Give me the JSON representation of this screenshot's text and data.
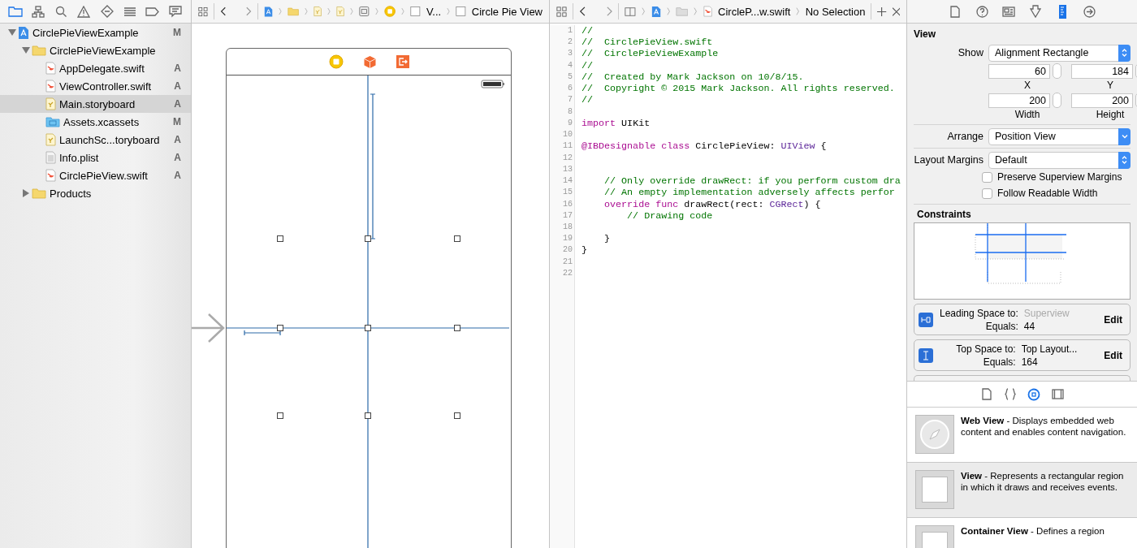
{
  "navigator": {
    "tabs": [
      {
        "kind": "folder",
        "selected": true
      },
      {
        "kind": "hierarchy",
        "selected": false
      },
      {
        "kind": "search",
        "selected": false
      },
      {
        "kind": "warning",
        "selected": false
      },
      {
        "kind": "diamond",
        "selected": false
      },
      {
        "kind": "list",
        "selected": false
      },
      {
        "kind": "tag",
        "selected": false
      },
      {
        "kind": "bubble",
        "selected": false
      }
    ],
    "tree": [
      {
        "name": "CirclePieViewExample",
        "kind": "project",
        "badge": "M",
        "expanded": true,
        "selected": false,
        "children": [
          {
            "name": "CirclePieViewExample",
            "kind": "folder",
            "expanded": true,
            "selected": false,
            "children": [
              {
                "name": "AppDelegate.swift",
                "kind": "swift",
                "badge": "A",
                "selected": false
              },
              {
                "name": "ViewController.swift",
                "kind": "swift",
                "badge": "A",
                "selected": false
              },
              {
                "name": "Main.storyboard",
                "kind": "storyboard",
                "badge": "A",
                "selected": true
              },
              {
                "name": "Assets.xcassets",
                "kind": "assets",
                "badge": "M",
                "selected": false
              },
              {
                "name": "LaunchSc...toryboard",
                "kind": "storyboard",
                "badge": "A",
                "selected": false
              },
              {
                "name": "Info.plist",
                "kind": "plist",
                "badge": "A",
                "selected": false
              },
              {
                "name": "CirclePieView.swift",
                "kind": "swift",
                "badge": "A",
                "selected": false
              }
            ]
          },
          {
            "name": "Products",
            "kind": "folder",
            "expanded": false,
            "selected": false
          }
        ]
      }
    ]
  },
  "canvas": {
    "breadcrumbs": [
      {
        "kind": "project"
      },
      {
        "kind": "folder"
      },
      {
        "kind": "storyboard"
      },
      {
        "kind": "storyboard"
      },
      {
        "kind": "scene"
      },
      {
        "kind": "controller"
      },
      {
        "kind": "view",
        "label": "V..."
      },
      {
        "kind": "view",
        "label": "Circle Pie View"
      }
    ]
  },
  "editor": {
    "jump_bar": [
      {
        "kind": "project"
      },
      {
        "kind": "folder"
      },
      {
        "kind": "swift",
        "label": "CircleP...w.swift"
      },
      {
        "kind": "none",
        "label": "No Selection"
      }
    ],
    "lines": [
      {
        "number": "1",
        "tokens": [
          {
            "kind": "comment",
            "text": "//"
          }
        ]
      },
      {
        "number": "2",
        "tokens": [
          {
            "kind": "comment",
            "text": "//  CirclePieView.swift"
          }
        ]
      },
      {
        "number": "3",
        "tokens": [
          {
            "kind": "comment",
            "text": "//  CirclePieViewExample"
          }
        ]
      },
      {
        "number": "4",
        "tokens": [
          {
            "kind": "comment",
            "text": "//"
          }
        ]
      },
      {
        "number": "5",
        "tokens": [
          {
            "kind": "comment",
            "text": "//  Created by Mark Jackson on 10/8/15."
          }
        ]
      },
      {
        "number": "6",
        "tokens": [
          {
            "kind": "comment",
            "text": "//  Copyright © 2015 Mark Jackson. All rights reserved."
          }
        ]
      },
      {
        "number": "7",
        "tokens": [
          {
            "kind": "comment",
            "text": "//"
          }
        ]
      },
      {
        "number": "8"
      },
      {
        "number": "9",
        "tokens": [
          {
            "kind": "keyword",
            "text": "import"
          },
          {
            "kind": "plain",
            "text": " UIKit"
          }
        ]
      },
      {
        "number": "10"
      },
      {
        "number": "11",
        "tokens": [
          {
            "kind": "keyword",
            "text": "@IBDesignable class"
          },
          {
            "kind": "plain",
            "text": " CirclePieView: "
          },
          {
            "kind": "type",
            "text": "UIView"
          },
          {
            "kind": "plain",
            "text": " {"
          }
        ]
      },
      {
        "number": "12"
      },
      {
        "number": "13"
      },
      {
        "number": "14",
        "tokens": [
          {
            "kind": "comment",
            "text": "    // Only override drawRect: if you perform custom dra"
          }
        ]
      },
      {
        "number": "15",
        "tokens": [
          {
            "kind": "comment",
            "text": "    // An empty implementation adversely affects perfor"
          }
        ]
      },
      {
        "number": "16",
        "tokens": [
          {
            "kind": "keyword",
            "text": "    override func"
          },
          {
            "kind": "plain",
            "text": " drawRect(rect: "
          },
          {
            "kind": "type",
            "text": "CGRect"
          },
          {
            "kind": "plain",
            "text": ") {"
          }
        ]
      },
      {
        "number": "17",
        "tokens": [
          {
            "kind": "comment",
            "text": "        // Drawing code"
          }
        ]
      },
      {
        "number": "18"
      },
      {
        "number": "19",
        "tokens": [
          {
            "kind": "plain",
            "text": "    }"
          }
        ]
      },
      {
        "number": "20",
        "tokens": [
          {
            "kind": "plain",
            "text": "}"
          }
        ]
      },
      {
        "number": "21"
      },
      {
        "number": "22"
      }
    ]
  },
  "inspector": {
    "tabs": [
      {
        "kind": "file",
        "selected": false
      },
      {
        "kind": "help",
        "selected": false
      },
      {
        "kind": "identity",
        "selected": false
      },
      {
        "kind": "attributes",
        "selected": false
      },
      {
        "kind": "size",
        "selected": true
      },
      {
        "kind": "connections",
        "selected": false
      }
    ],
    "section": "View",
    "show": {
      "label": "Show",
      "value": "Alignment Rectangle",
      "kind": "updown"
    },
    "frame": [
      {
        "label": "X",
        "value": "60"
      },
      {
        "label": "Y",
        "value": "184"
      },
      {
        "label": "Width",
        "value": "200"
      },
      {
        "label": "Height",
        "value": "200"
      }
    ],
    "arrange": {
      "label": "Arrange",
      "value": "Position View",
      "kind": "pulldown"
    },
    "layout_margins": {
      "label": "Layout Margins",
      "value": "Default",
      "kind": "updown"
    },
    "checkboxes": [
      {
        "label": "Preserve Superview Margins",
        "checked": false
      },
      {
        "label": "Follow Readable Width",
        "checked": false
      }
    ],
    "constraints_title": "Constraints",
    "constraints": [
      {
        "kind": "leading",
        "label": "Leading Space to:",
        "target": "Superview",
        "dimmed": true,
        "equals": "Equals:",
        "value": "44",
        "action": "Edit"
      },
      {
        "kind": "top",
        "label": "Top Space to:",
        "target": "Top Layout...",
        "dimmed": false,
        "equals": "Equals:",
        "value": "164",
        "action": "Edit"
      }
    ]
  },
  "library": {
    "tabs": [
      {
        "kind": "file",
        "selected": false
      },
      {
        "kind": "braces",
        "selected": false
      },
      {
        "kind": "object",
        "selected": true
      },
      {
        "kind": "media",
        "selected": false
      }
    ],
    "items": [
      {
        "kind": "web",
        "title": "Web View",
        "description": " - Displays embedded web content and enables content navigation.",
        "selected": false
      },
      {
        "kind": "view",
        "title": "View",
        "description": " - Represents a rectangular region in which it draws and receives events.",
        "selected": true
      },
      {
        "kind": "view",
        "title": "Container View",
        "description": " - Defines a region",
        "selected": false
      }
    ]
  }
}
